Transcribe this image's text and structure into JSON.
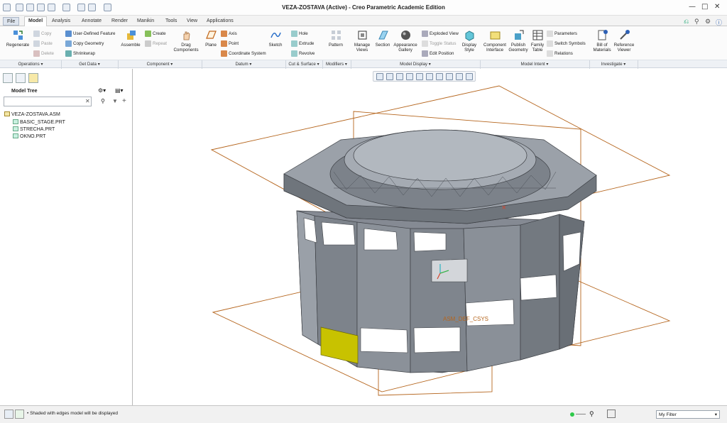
{
  "window": {
    "title": "VEZA-ZOSTAVA (Active) - Creo Parametric Academic Edition"
  },
  "tabs": [
    "File",
    "Model",
    "Analysis",
    "Annotate",
    "Render",
    "Manikin",
    "Tools",
    "View",
    "Applications"
  ],
  "active_tab": "Model",
  "ribbon": {
    "operations": {
      "regenerate": "Regenerate",
      "copy": "Copy",
      "paste": "Paste",
      "delete": "Delete"
    },
    "get_data": {
      "udf": "User-Defined Feature",
      "copy_geometry": "Copy Geometry",
      "shrinkwrap": "Shrinkwrap"
    },
    "component": {
      "assemble": "Assemble",
      "create": "Create",
      "repeat": "Repeat",
      "drag": "Drag Components"
    },
    "datum": {
      "plane": "Plane",
      "axis": "Axis",
      "point": "Point",
      "csys": "Coordinate System",
      "sketch": "Sketch"
    },
    "cut_surface": {
      "hole": "Hole",
      "extrude": "Extrude",
      "revolve": "Revolve"
    },
    "modifiers": {
      "pattern": "Pattern"
    },
    "model_display": {
      "manage_views": "Manage Views",
      "section": "Section",
      "appearance": "Appearance Gallery",
      "exploded": "Exploded View",
      "toggle_status": "Toggle Status",
      "edit_position": "Edit Position",
      "display_style": "Display Style"
    },
    "model_intent": {
      "component_interface": "Component Interface",
      "publish_geometry": "Publish Geometry",
      "family_table": "Family Table",
      "parameters": "Parameters",
      "switch_symbols": "Switch Symbols",
      "relations": "Relations"
    },
    "investigate": {
      "bom": "Bill of Materials",
      "reference_viewer": "Reference Viewer"
    },
    "groups": [
      "Operations",
      "Get Data",
      "Component",
      "Datum",
      "Cut & Surface",
      "Modifiers",
      "Model Display",
      "Model Intent",
      "Investigate"
    ]
  },
  "model_tree": {
    "title": "Model Tree",
    "search_placeholder": "",
    "items": [
      "VEZA-ZOSTAVA.ASM",
      "BASIC_STAGE.PRT",
      "STRECHA.PRT",
      "OKNO.PRT"
    ]
  },
  "viewport": {
    "csys_label": "ASM_DEF_CSYS"
  },
  "status": {
    "message": "Shaded with edges model will be displayed",
    "filter": "My Filter"
  },
  "colors": {
    "model_gray": "#8a9098",
    "datum_orange": "#b5651d",
    "highlight_yellow": "#c8c200"
  },
  "icons": [
    "undo-icon",
    "redo-icon",
    "save-icon",
    "open-icon",
    "new-icon",
    "regenerate-icon",
    "plane-icon",
    "sketch-icon",
    "section-icon",
    "appearance-icon",
    "display-style-icon",
    "zoom-in-icon",
    "zoom-out-icon",
    "refit-icon",
    "filter-icon",
    "settings-icon",
    "help-icon"
  ]
}
